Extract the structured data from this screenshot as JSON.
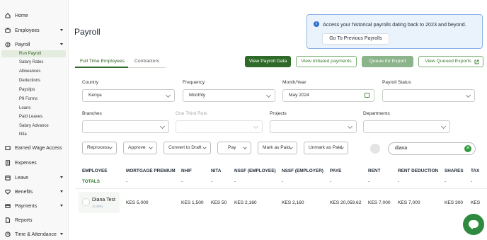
{
  "sidebar": {
    "home": "Home",
    "employees": "Employees",
    "payroll": "Payroll",
    "payroll_sub": [
      "Run Payroll",
      "Salary Rates",
      "Allowances",
      "Deductions",
      "Payslips",
      "P9 Forms",
      "Loans",
      "Paid Leaves",
      "Salary Advance",
      "Nita"
    ],
    "ewa": "Earned Wage Access",
    "expenses": "Expenses",
    "leave": "Leave",
    "benefits": "Benefits",
    "payments": "Payments",
    "reports": "Reports",
    "time": "Time & Attendance"
  },
  "header": {
    "title": "Payroll",
    "banner_text": "Access your historical payrolls dating back to 2023 and beyond.",
    "banner_button": "Go To Previous Payrolls"
  },
  "tabs": [
    "Full Time Employees",
    "Contractors"
  ],
  "toolbar": {
    "view_payroll": "View Payroll Data",
    "view_initiated": "View initiated payments",
    "queue_export": "Queue for Export",
    "view_queued": "View Queued Exports"
  },
  "filters": {
    "country_label": "Country",
    "country_value": "Kenya",
    "frequency_label": "Frequency",
    "frequency_value": "Monthly",
    "month_label": "Month/Year",
    "month_value": "May 2024",
    "status_label": "Payroll Status",
    "status_value": "",
    "branches_label": "Branches",
    "third_rule_label": "One Third Rule",
    "projects_label": "Projects",
    "departments_label": "Departments"
  },
  "actions": {
    "reprocess": "Reprocess",
    "approve": "Approve",
    "convert": "Convert to Draft",
    "pay": "Pay",
    "mark_paid": "Mark as Paid",
    "unmark_paid": "Unmark as Paid"
  },
  "search": {
    "value": "diana"
  },
  "table": {
    "headers": [
      "EMPLOYEE",
      "MORTGAGE PREMIUM",
      "NHIF",
      "NITA",
      "NSSF (EMPLOYEE)",
      "NSSF (EMPLOYER)",
      "PAYE",
      "RENT",
      "RENT DEDUCTION",
      "SHARES",
      "TAX"
    ],
    "totals_label": "TOTALS",
    "totals": [
      "-",
      "-",
      "-",
      "-",
      "-",
      "-",
      "-",
      "-",
      "-",
      "-"
    ],
    "row": {
      "name": "Diana Test",
      "code": "JC4081",
      "values": [
        "KES 5,000",
        "KES 1,500",
        "KES 50",
        "KES 2,160",
        "KES 2,160",
        "KES 20,059.62",
        "KES 7,000",
        "KES 7,000",
        "KES 300",
        "KES"
      ]
    }
  },
  "colors": {
    "brand": "#2f6a2a",
    "banner_bg": "#eaf2fb",
    "accent_blue": "#2e6fd1"
  }
}
